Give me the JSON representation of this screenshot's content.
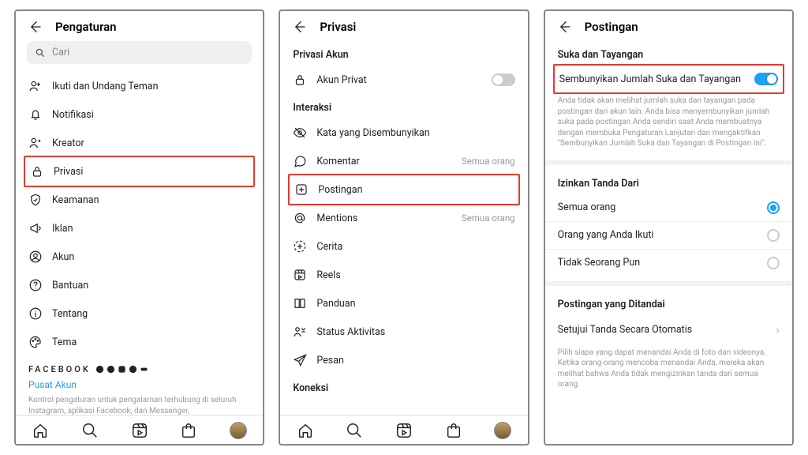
{
  "screen1": {
    "title": "Pengaturan",
    "search_placeholder": "Cari",
    "items": [
      "Ikuti dan Undang Teman",
      "Notifikasi",
      "Kreator",
      "Privasi",
      "Keamanan",
      "Iklan",
      "Akun",
      "Bantuan",
      "Tentang",
      "Tema"
    ],
    "fb_label": "FACEBOOK",
    "account_center": "Pusat Akun",
    "footer_desc": "Kontrol pengaturan untuk pengalaman terhubung di seluruh Instagram, aplikasi Facebook, dan Messenger,"
  },
  "screen2": {
    "title": "Privasi",
    "section_privacy": "Privasi Akun",
    "private_account": "Akun Privat",
    "section_interaction": "Interaksi",
    "items": [
      {
        "label": "Kata yang Disembunyikan",
        "meta": ""
      },
      {
        "label": "Komentar",
        "meta": "Semua orang"
      },
      {
        "label": "Postingan",
        "meta": ""
      },
      {
        "label": "Mentions",
        "meta": "Semua orang"
      },
      {
        "label": "Cerita",
        "meta": ""
      },
      {
        "label": "Reels",
        "meta": ""
      },
      {
        "label": "Panduan",
        "meta": ""
      },
      {
        "label": "Status Aktivitas",
        "meta": ""
      },
      {
        "label": "Pesan",
        "meta": ""
      }
    ],
    "section_connection": "Koneksi"
  },
  "screen3": {
    "title": "Postingan",
    "section_likes": "Suka dan Tayangan",
    "hide_likes": "Sembunyikan Jumlah Suka dan Tayangan",
    "hide_desc": "Anda tidak akan melihat jumlah suka dan tayangan pada postingan dari akun lain. Anda bisa menyembunyikan jumlah suka pada postingan Anda sendiri saat Anda membuatnya dengan membuka Pengaturan Lanjutan dan mengaktifkan \"Sembunyikan Jumlah Suka dan Tayangan di Postingan Ini\".",
    "section_tags": "Izinkan Tanda Dari",
    "tag_opts": [
      "Semua orang",
      "Orang yang Anda Ikuti",
      "Tidak Seorang Pun"
    ],
    "section_tagged": "Postingan yang Ditandai",
    "auto_approve": "Setujui Tanda Secara Otomatis",
    "tagged_desc": "Pilih siapa yang dapat menandai Anda di foto dan videonya. Ketika orang-orang mencoba menandai Anda, mereka akan melihat bahwa Anda tidak mengizinkan tanda dari semua orang."
  }
}
